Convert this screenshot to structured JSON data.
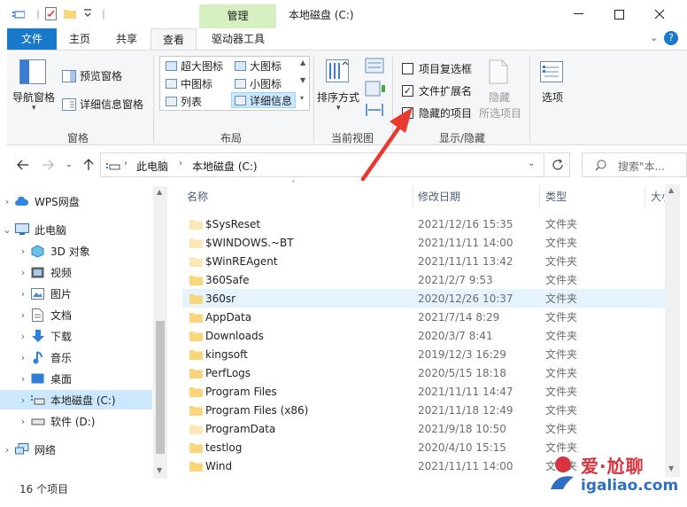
{
  "titlebar": {
    "contextual_tab": "管理",
    "title": "本地磁盘 (C:)"
  },
  "tabs": {
    "file": "文件",
    "home": "主页",
    "share": "共享",
    "view": "查看",
    "drive_tools": "驱动器工具"
  },
  "ribbon": {
    "panes": {
      "nav_pane": "导航窗格",
      "preview_pane": "预览窗格",
      "details_pane": "详细信息窗格",
      "label": "窗格"
    },
    "layout": {
      "extra_large": "超大图标",
      "large": "大图标",
      "medium": "中图标",
      "small": "小图标",
      "list": "列表",
      "details": "详细信息",
      "label": "布局"
    },
    "current_view": {
      "sort_by": "排序方式",
      "label": "当前视图"
    },
    "show_hide": {
      "item_checkboxes": "项目复选框",
      "item_checkboxes_checked": false,
      "file_extensions": "文件扩展名",
      "file_extensions_checked": true,
      "hidden_items": "隐藏的项目",
      "hidden_items_checked": true,
      "hide_selected_1": "隐藏",
      "hide_selected_2": "所选项目",
      "label": "显示/隐藏"
    },
    "options": "选项"
  },
  "address": {
    "crumbs": [
      "此电脑",
      "本地磁盘 (C:)"
    ],
    "search_placeholder": "搜索\"本..."
  },
  "nav": {
    "items": [
      {
        "label": "WPS网盘",
        "icon": "cloud-icon"
      },
      {
        "label": "此电脑",
        "icon": "computer-icon"
      },
      {
        "label": "3D 对象",
        "icon": "3d-objects-icon"
      },
      {
        "label": "视频",
        "icon": "video-icon"
      },
      {
        "label": "图片",
        "icon": "pictures-icon"
      },
      {
        "label": "文档",
        "icon": "documents-icon"
      },
      {
        "label": "下载",
        "icon": "download-icon"
      },
      {
        "label": "音乐",
        "icon": "music-icon"
      },
      {
        "label": "桌面",
        "icon": "desktop-icon"
      },
      {
        "label": "本地磁盘 (C:)",
        "icon": "drive-c-icon"
      },
      {
        "label": "软件 (D:)",
        "icon": "drive-d-icon"
      },
      {
        "label": "网络",
        "icon": "network-icon"
      }
    ]
  },
  "columns": {
    "name": "名称",
    "date": "修改日期",
    "type": "类型",
    "size": "大小"
  },
  "files": [
    {
      "name": "$SysReset",
      "date": "2021/12/16 15:35",
      "type": "文件夹",
      "hidden": true
    },
    {
      "name": "$WINDOWS.~BT",
      "date": "2021/11/11 14:00",
      "type": "文件夹",
      "hidden": true
    },
    {
      "name": "$WinREAgent",
      "date": "2021/11/11 13:42",
      "type": "文件夹",
      "hidden": true
    },
    {
      "name": "360Safe",
      "date": "2021/2/7 9:53",
      "type": "文件夹",
      "hidden": false
    },
    {
      "name": "360sr",
      "date": "2020/12/26 10:37",
      "type": "文件夹",
      "hidden": false
    },
    {
      "name": "AppData",
      "date": "2021/7/14 8:29",
      "type": "文件夹",
      "hidden": false
    },
    {
      "name": "Downloads",
      "date": "2020/3/7 8:41",
      "type": "文件夹",
      "hidden": false
    },
    {
      "name": "kingsoft",
      "date": "2019/12/3 16:29",
      "type": "文件夹",
      "hidden": false
    },
    {
      "name": "PerfLogs",
      "date": "2020/5/15 18:18",
      "type": "文件夹",
      "hidden": false
    },
    {
      "name": "Program Files",
      "date": "2021/11/11 14:47",
      "type": "文件夹",
      "hidden": false
    },
    {
      "name": "Program Files (x86)",
      "date": "2021/11/18 12:49",
      "type": "文件夹",
      "hidden": false
    },
    {
      "name": "ProgramData",
      "date": "2021/9/18 10:50",
      "type": "文件夹",
      "hidden": true
    },
    {
      "name": "testlog",
      "date": "2020/4/10 15:15",
      "type": "文件夹",
      "hidden": false
    },
    {
      "name": "Wind",
      "date": "2021/11/11 14:00",
      "type": "文件夹",
      "hidden": false
    }
  ],
  "status": "16 个项目",
  "watermark": {
    "text": "爱·尬聊",
    "url": "igaliao.com"
  },
  "colors": {
    "file_tab": "#1979ca",
    "context_tab": "#d6f0c2",
    "selection": "#cce8ff",
    "annotation_arrow": "#e8392f",
    "folder": "#f9d57b"
  }
}
